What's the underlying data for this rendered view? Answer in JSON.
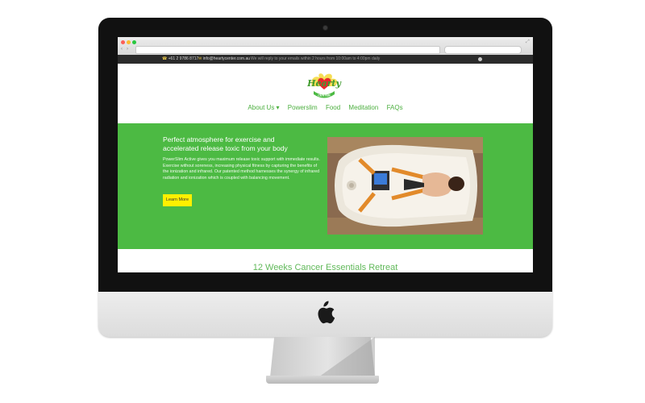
{
  "browser": {
    "nav_back": "‹",
    "nav_forward": "›"
  },
  "topbar": {
    "phone": "+61 2 9786 8717",
    "email": "info@heartycenter.com.au",
    "note": "We will reply to your emails within 2 hours from 10:00am to 4:00pm daily"
  },
  "logo": {
    "text": "Hearty",
    "subtext": "CENTER"
  },
  "menu": {
    "items": [
      "About Us ▾",
      "Powerslim",
      "Food",
      "Meditation",
      "FAQs"
    ]
  },
  "hero": {
    "title": "Perfect atmosphere for exercise and accelerated release toxic from your body",
    "text": "PowerSlim Active gives you maximum release toxic support with immediate results. Exercise without soreness, increasing physical fitness by capturing the benefits of the ionization and infrared. Our patented method harnesses the synergy of infrared radiation and ionization which is coupled with balancing movement.",
    "button": "Learn More"
  },
  "section": {
    "title": "12 Weeks Cancer Essentials Retreat"
  },
  "colors": {
    "brand_green": "#4cba43",
    "button_yellow": "#fff000",
    "topbar": "#2b2b2b"
  },
  "icons": [
    "phone-icon",
    "mail-icon",
    "globe-icon",
    "apple-logo-icon"
  ]
}
